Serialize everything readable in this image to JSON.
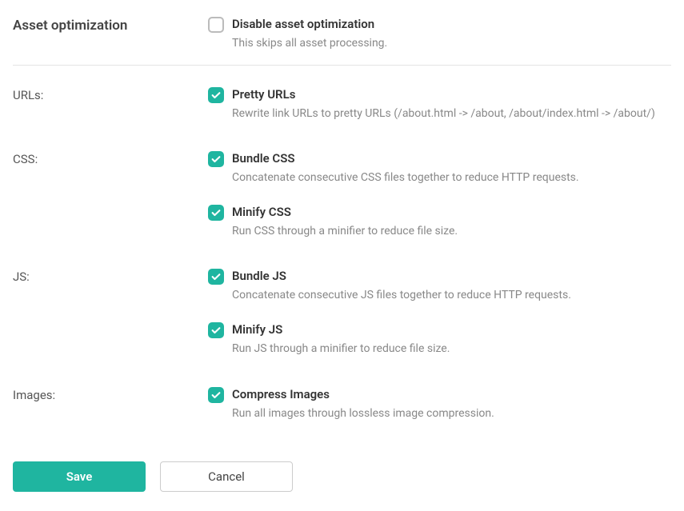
{
  "section_title": "Asset optimization",
  "disable": {
    "title": "Disable asset optimization",
    "desc": "This skips all asset processing.",
    "checked": false
  },
  "groups": {
    "urls": {
      "label": "URLs:",
      "items": [
        {
          "title": "Pretty URLs",
          "desc": "Rewrite link URLs to pretty URLs (/about.html -> /about, /about/index.html -> /about/)",
          "checked": true
        }
      ]
    },
    "css": {
      "label": "CSS:",
      "items": [
        {
          "title": "Bundle CSS",
          "desc": "Concatenate consecutive CSS files together to reduce HTTP requests.",
          "checked": true
        },
        {
          "title": "Minify CSS",
          "desc": "Run CSS through a minifier to reduce file size.",
          "checked": true
        }
      ]
    },
    "js": {
      "label": "JS:",
      "items": [
        {
          "title": "Bundle JS",
          "desc": "Concatenate consecutive JS files together to reduce HTTP requests.",
          "checked": true
        },
        {
          "title": "Minify JS",
          "desc": "Run JS through a minifier to reduce file size.",
          "checked": true
        }
      ]
    },
    "images": {
      "label": "Images:",
      "items": [
        {
          "title": "Compress Images",
          "desc": "Run all images through lossless image compression.",
          "checked": true
        }
      ]
    }
  },
  "buttons": {
    "save": "Save",
    "cancel": "Cancel"
  }
}
